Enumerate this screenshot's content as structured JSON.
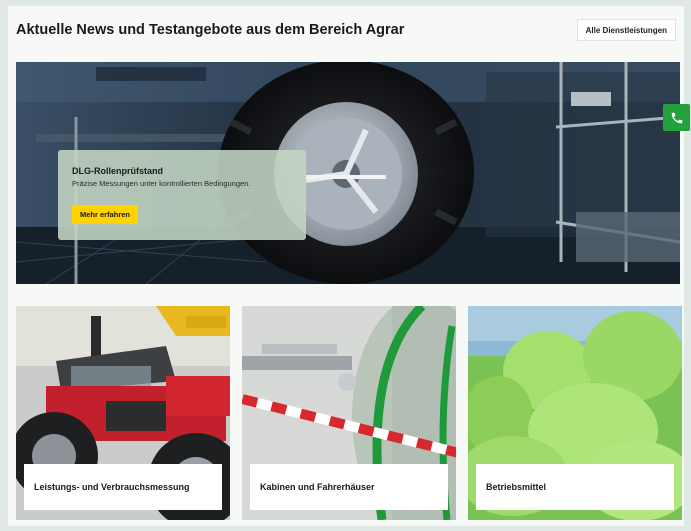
{
  "header": {
    "title": "Aktuelle News und Testangebote aus dem Bereich Agrar",
    "all_services_label": "Alle Dienstleistungen"
  },
  "hero": {
    "title": "DLG-Rollenprüfstand",
    "subtitle": "Präzise Messungen unter kontrollierten Bedingungen.",
    "cta_label": "Mehr erfahren"
  },
  "phone_tab": {
    "icon": "phone-icon",
    "color": "#23a13d"
  },
  "cards": [
    {
      "label": "Leistungs- und Verbrauchsmessung"
    },
    {
      "label": "Kabinen und Fahrerhäuser"
    },
    {
      "label": "Betriebsmittel"
    }
  ],
  "colors": {
    "accent_yellow": "#ffd200",
    "brand_green": "#23a13d"
  }
}
